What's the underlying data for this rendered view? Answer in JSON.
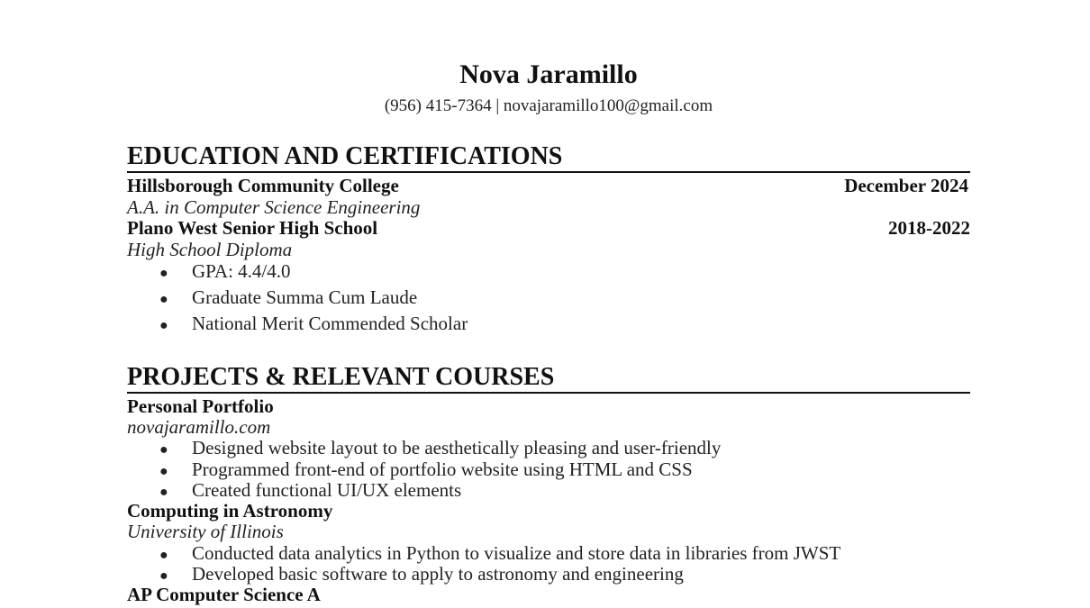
{
  "header": {
    "name": "Nova Jaramillo",
    "contact": "(956) 415-7364 | novajaramillo100@gmail.com"
  },
  "education": {
    "heading": "EDUCATION AND CERTIFICATIONS",
    "entries": [
      {
        "school": "Hillsborough Community College",
        "date": "December 2024",
        "degree": "A.A. in Computer Science Engineering"
      },
      {
        "school": "Plano West Senior High School",
        "date": "2018-2022",
        "degree": "High School Diploma",
        "bullets": [
          "GPA: 4.4/4.0",
          "Graduate Summa Cum Laude",
          "National Merit Commended Scholar"
        ]
      }
    ]
  },
  "projects": {
    "heading": "PROJECTS & RELEVANT COURSES",
    "entries": [
      {
        "title": "Personal Portfolio",
        "subtitle": "novajaramillo.com",
        "bullets": [
          "Designed website layout to be aesthetically pleasing and user-friendly",
          "Programmed front-end of portfolio website using HTML and CSS",
          "Created functional UI/UX elements"
        ]
      },
      {
        "title": "Computing in Astronomy",
        "subtitle": "University of Illinois",
        "bullets": [
          "Conducted data analytics in Python to visualize and store data in libraries from JWST",
          "Developed basic software to apply to astronomy and engineering"
        ]
      },
      {
        "title": "AP Computer Science A"
      }
    ]
  },
  "bullet_glyph": "●"
}
